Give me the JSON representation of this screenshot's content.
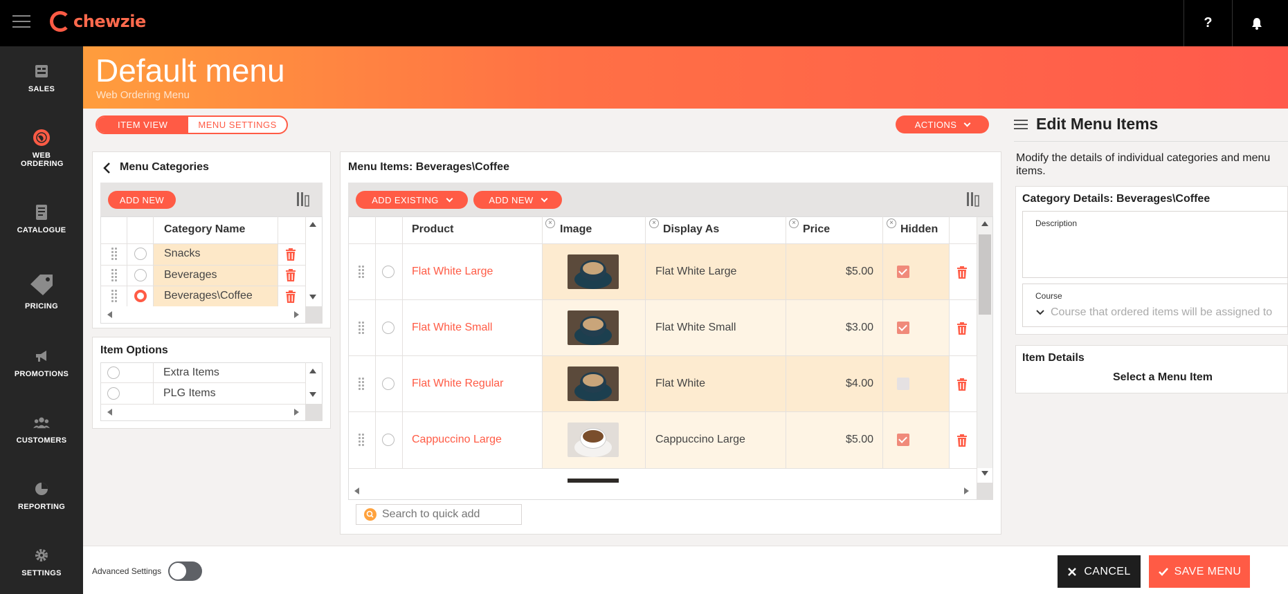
{
  "app": {
    "brand": "chewzie",
    "help_label": "?"
  },
  "sidebar": {
    "items": [
      {
        "label": "SALES",
        "icon": "sales-icon"
      },
      {
        "label": "WEB ORDERING",
        "icon": "globe-icon",
        "active": true
      },
      {
        "label": "CATALOGUE",
        "icon": "catalogue-icon"
      },
      {
        "label": "PRICING",
        "icon": "price-tag-icon"
      },
      {
        "label": "PROMOTIONS",
        "icon": "megaphone-icon"
      },
      {
        "label": "CUSTOMERS",
        "icon": "customers-icon"
      },
      {
        "label": "REPORTING",
        "icon": "pie-chart-icon"
      },
      {
        "label": "SETTINGS",
        "icon": "gear-icon"
      }
    ]
  },
  "header": {
    "title": "Default menu",
    "subtitle": "Web Ordering Menu"
  },
  "view_toggle": {
    "item_view": "ITEM VIEW",
    "menu_settings": "MENU SETTINGS"
  },
  "actions_label": "ACTIONS",
  "categories": {
    "title": "Menu Categories",
    "add_new": "ADD NEW",
    "column": "Category Name",
    "rows": [
      {
        "name": "Snacks",
        "selected": false
      },
      {
        "name": "Beverages",
        "selected": false
      },
      {
        "name": "Beverages\\Coffee",
        "selected": true
      }
    ]
  },
  "item_options": {
    "title": "Item Options",
    "rows": [
      "Extra Items",
      "PLG Items"
    ]
  },
  "menu_items": {
    "title": "Menu Items: Beverages\\Coffee",
    "add_existing": "ADD EXISTING",
    "add_new": "ADD NEW",
    "columns": {
      "product": "Product",
      "image": "Image",
      "display_as": "Display As",
      "price": "Price",
      "hidden": "Hidden"
    },
    "rows": [
      {
        "product": "Flat White Large",
        "display_as": "Flat White Large",
        "price": "$5.00",
        "hidden": true,
        "image": "flat-white-image"
      },
      {
        "product": "Flat White Small",
        "display_as": "Flat White Small",
        "price": "$3.00",
        "hidden": true,
        "image": "flat-white-image"
      },
      {
        "product": "Flat White Regular",
        "display_as": "Flat White",
        "price": "$4.00",
        "hidden": false,
        "image": "flat-white-image"
      },
      {
        "product": "Cappuccino Large",
        "display_as": "Cappuccino Large",
        "price": "$5.00",
        "hidden": true,
        "image": "cappuccino-image"
      }
    ],
    "search_placeholder": "Search to quick add"
  },
  "edit_panel": {
    "title": "Edit Menu Items",
    "description": "Modify the details of individual categories and menu items.",
    "category_details": "Category Details: Beverages\\Coffee",
    "description_label": "Description",
    "course_label": "Course",
    "course_placeholder": "Course that ordered items will be assigned to",
    "item_details": "Item Details",
    "select_prompt": "Select a Menu Item"
  },
  "footer": {
    "advanced_settings": "Advanced Settings",
    "cancel": "CANCEL",
    "save": "SAVE MENU"
  },
  "colors": {
    "accent": "#ff5b45",
    "sidebar": "#262626",
    "topbar": "#000000",
    "row_highlight": "#fde8c8"
  }
}
